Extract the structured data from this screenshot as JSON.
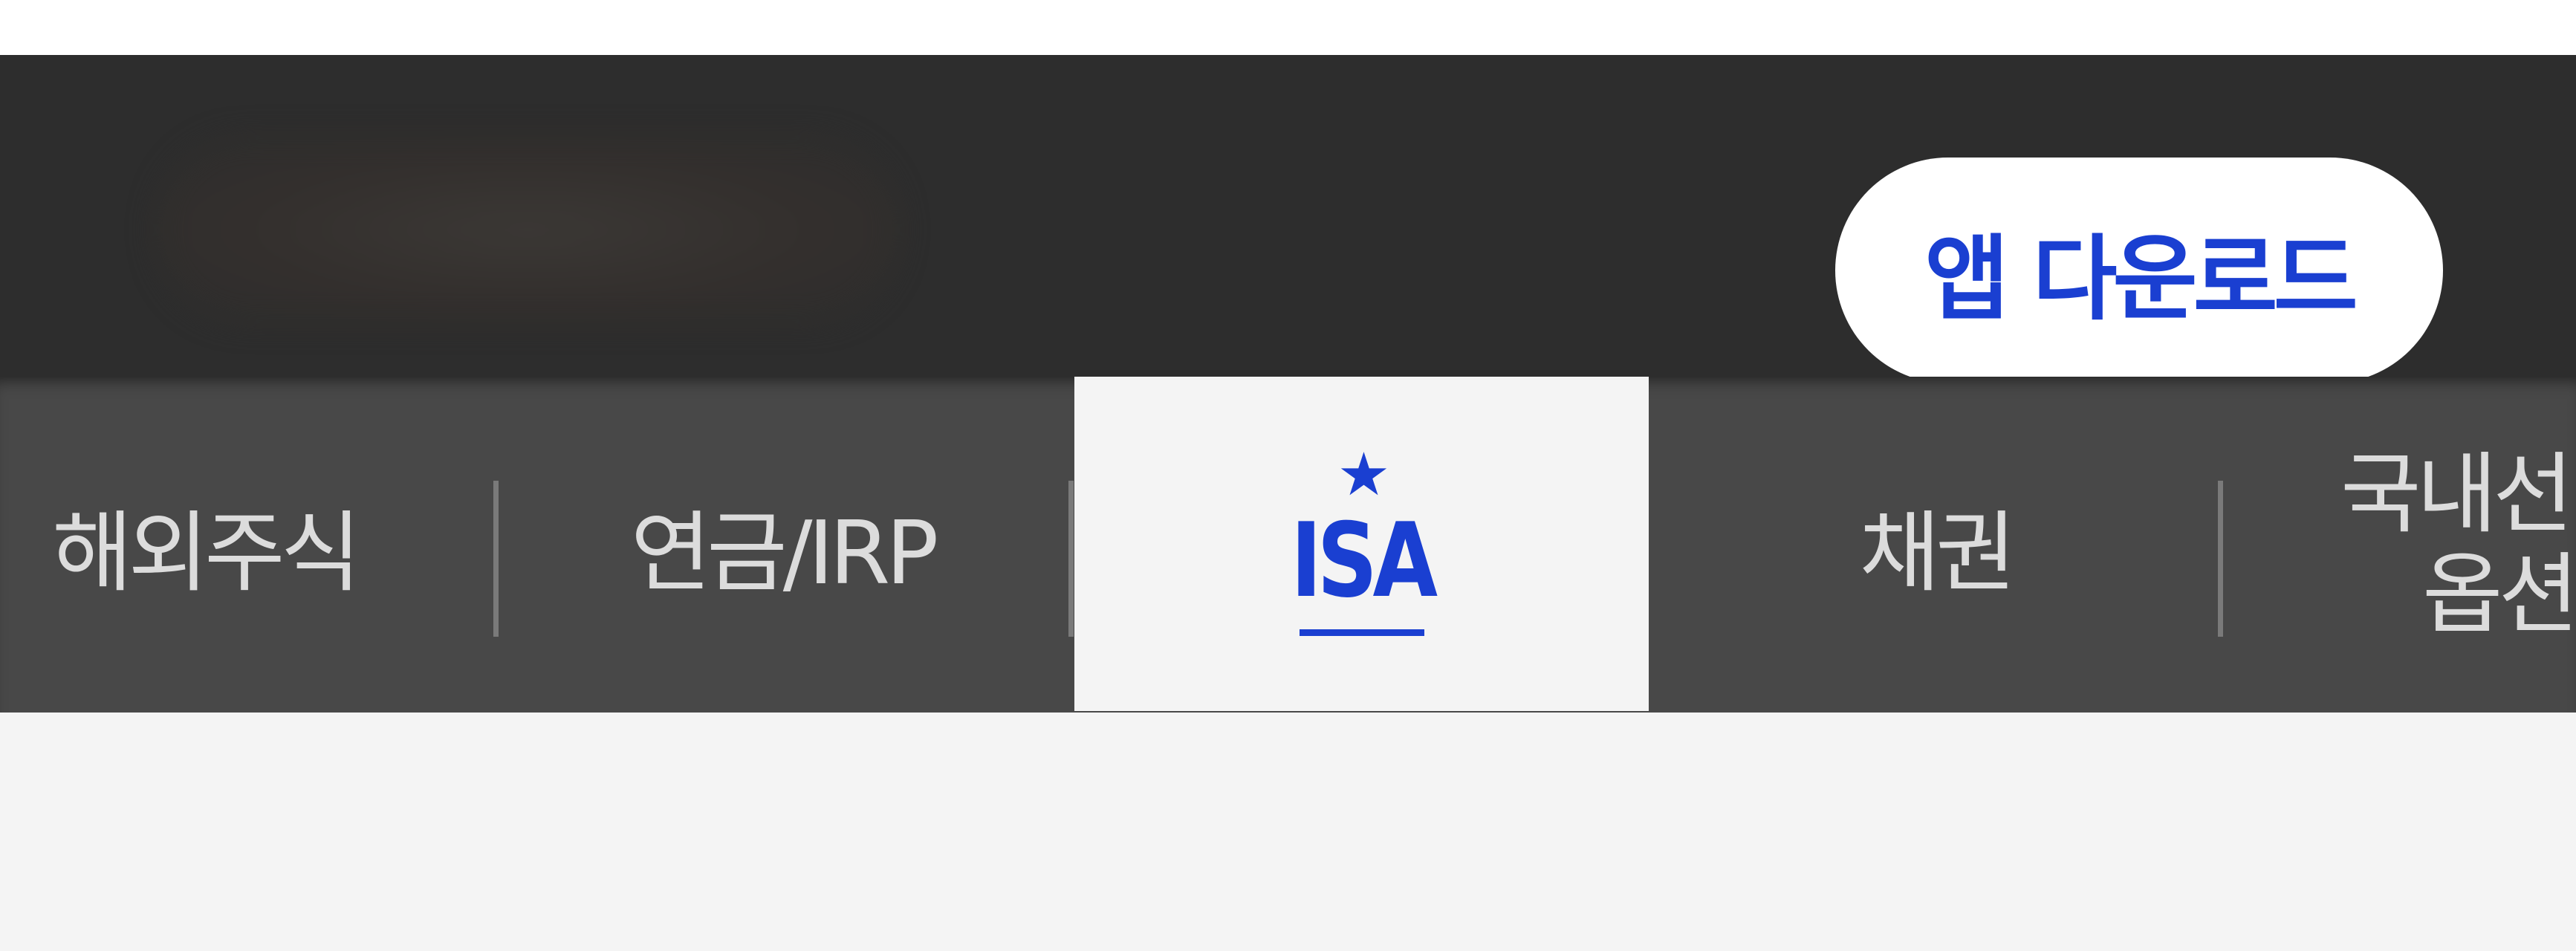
{
  "header": {
    "download_label": "앱 다운로드"
  },
  "tabs": [
    {
      "label": "해외주식"
    },
    {
      "label": "연금/IRP"
    },
    {
      "label": "ISA",
      "active": true,
      "star_icon": "star-icon"
    },
    {
      "label": "채권"
    },
    {
      "label_line1": "국내선",
      "label_line2": "옵션"
    }
  ],
  "colors": {
    "accent": "#1a3fd1",
    "header_bg": "#2d2d2d",
    "tabbar_bg": "#484848",
    "active_tab_bg": "#f4f4f4",
    "tab_text": "#dcdcdc"
  }
}
